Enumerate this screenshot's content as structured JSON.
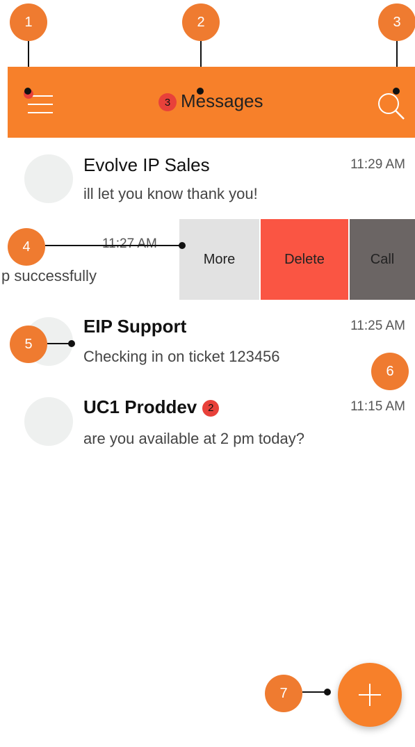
{
  "header": {
    "title": "Messages",
    "unread_badge": "3",
    "menu_icon": "hamburger-menu-icon",
    "search_icon": "search-icon",
    "color": "#f7802a"
  },
  "conversations": [
    {
      "name": "Evolve IP Sales",
      "preview": "ill let you know thank you!",
      "time": "11:29 AM",
      "bold": false
    },
    {
      "name": "",
      "preview": "p successfully",
      "time": "11:27 AM",
      "bold": false,
      "swiped": true
    },
    {
      "name": "EIP Support",
      "preview": "Checking in on ticket 123456",
      "time": "11:25 AM",
      "bold": true
    },
    {
      "name": "UC1 Proddev",
      "preview": "are you available at 2 pm today?",
      "time": "11:15 AM",
      "bold": true,
      "badge": "2"
    }
  ],
  "swipe_actions": [
    {
      "label": "More",
      "color": "#e2e2e2"
    },
    {
      "label": "Delete",
      "color": "#fa5543"
    },
    {
      "label": "Call",
      "color": "#6b6564"
    }
  ],
  "fab": {
    "icon": "plus-icon"
  },
  "callouts": [
    "1",
    "2",
    "3",
    "4",
    "5",
    "6",
    "7"
  ]
}
